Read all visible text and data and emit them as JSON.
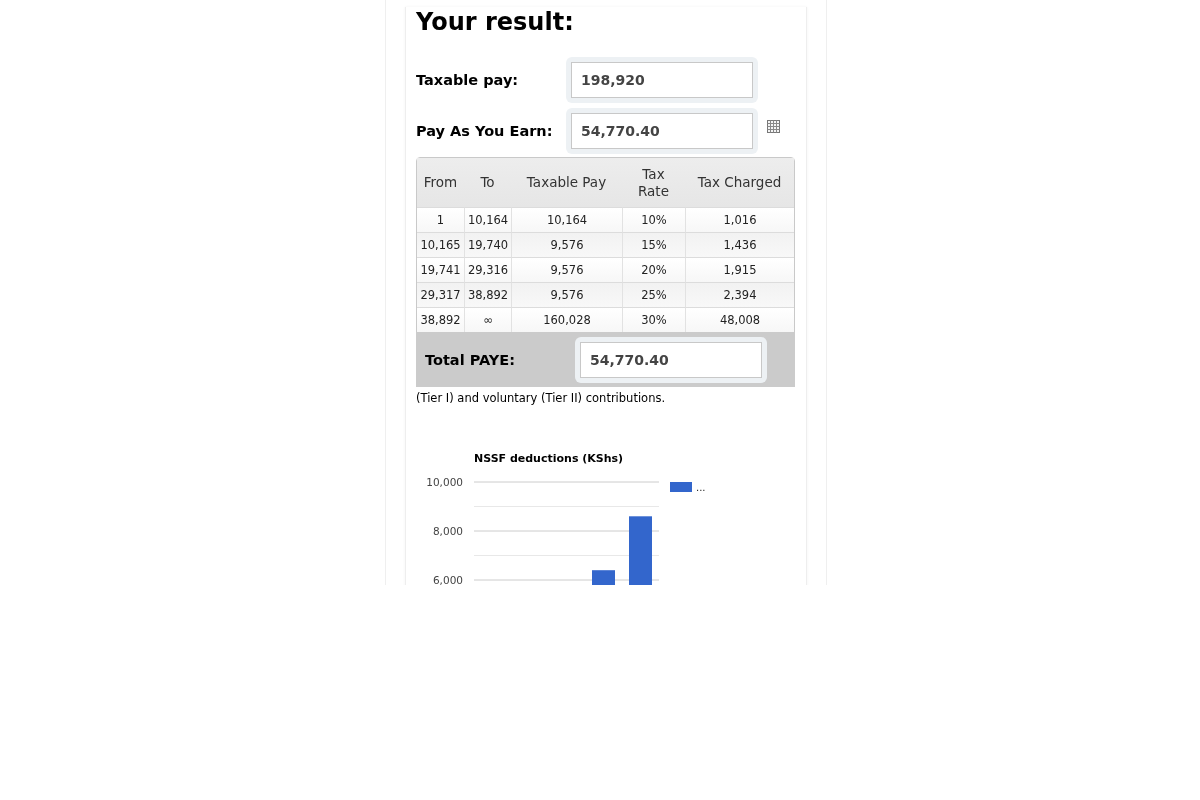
{
  "heading": "Your result:",
  "fields": [
    {
      "label": "Taxable pay:",
      "value": "198,920",
      "kind": "plain"
    },
    {
      "label": "Pay As You Earn:",
      "value": "54,770.40",
      "kind": "breakdown"
    }
  ],
  "tax_table": {
    "columns": [
      "From",
      "To",
      "Taxable Pay",
      "Tax Rate",
      "Tax Charged"
    ],
    "rows": [
      [
        "1",
        "10,164",
        "10,164",
        "10%",
        "1,016"
      ],
      [
        "10,165",
        "19,740",
        "9,576",
        "15%",
        "1,436"
      ],
      [
        "19,741",
        "29,316",
        "9,576",
        "20%",
        "1,915"
      ],
      [
        "29,317",
        "38,892",
        "9,576",
        "25%",
        "2,394"
      ],
      [
        "38,892",
        "∞",
        "160,028",
        "30%",
        "48,008"
      ]
    ]
  },
  "total": {
    "label": "Total PAYE:",
    "value": "54,770.40"
  },
  "note": "(Tier I) and voluntary (Tier II) contributions.",
  "chart": {
    "chart_data": {
      "type": "bar",
      "title": "NSSF deductions (KShs)",
      "categories": [
        null,
        null,
        null,
        null,
        null
      ],
      "ylim": [
        5800,
        10000
      ],
      "yticks": [
        {
          "value": 6000,
          "label": "6,000"
        },
        {
          "value": 8000,
          "label": "8,000"
        },
        {
          "value": 10000,
          "label": "10,000"
        }
      ],
      "ref_lines": [
        {
          "axis": "y",
          "value": 7000
        },
        {
          "axis": "y",
          "value": 9000
        }
      ],
      "series": [
        {
          "name": "...",
          "color": "#3366cc",
          "values": [
            null,
            null,
            null,
            6400,
            8600
          ]
        }
      ]
    }
  }
}
